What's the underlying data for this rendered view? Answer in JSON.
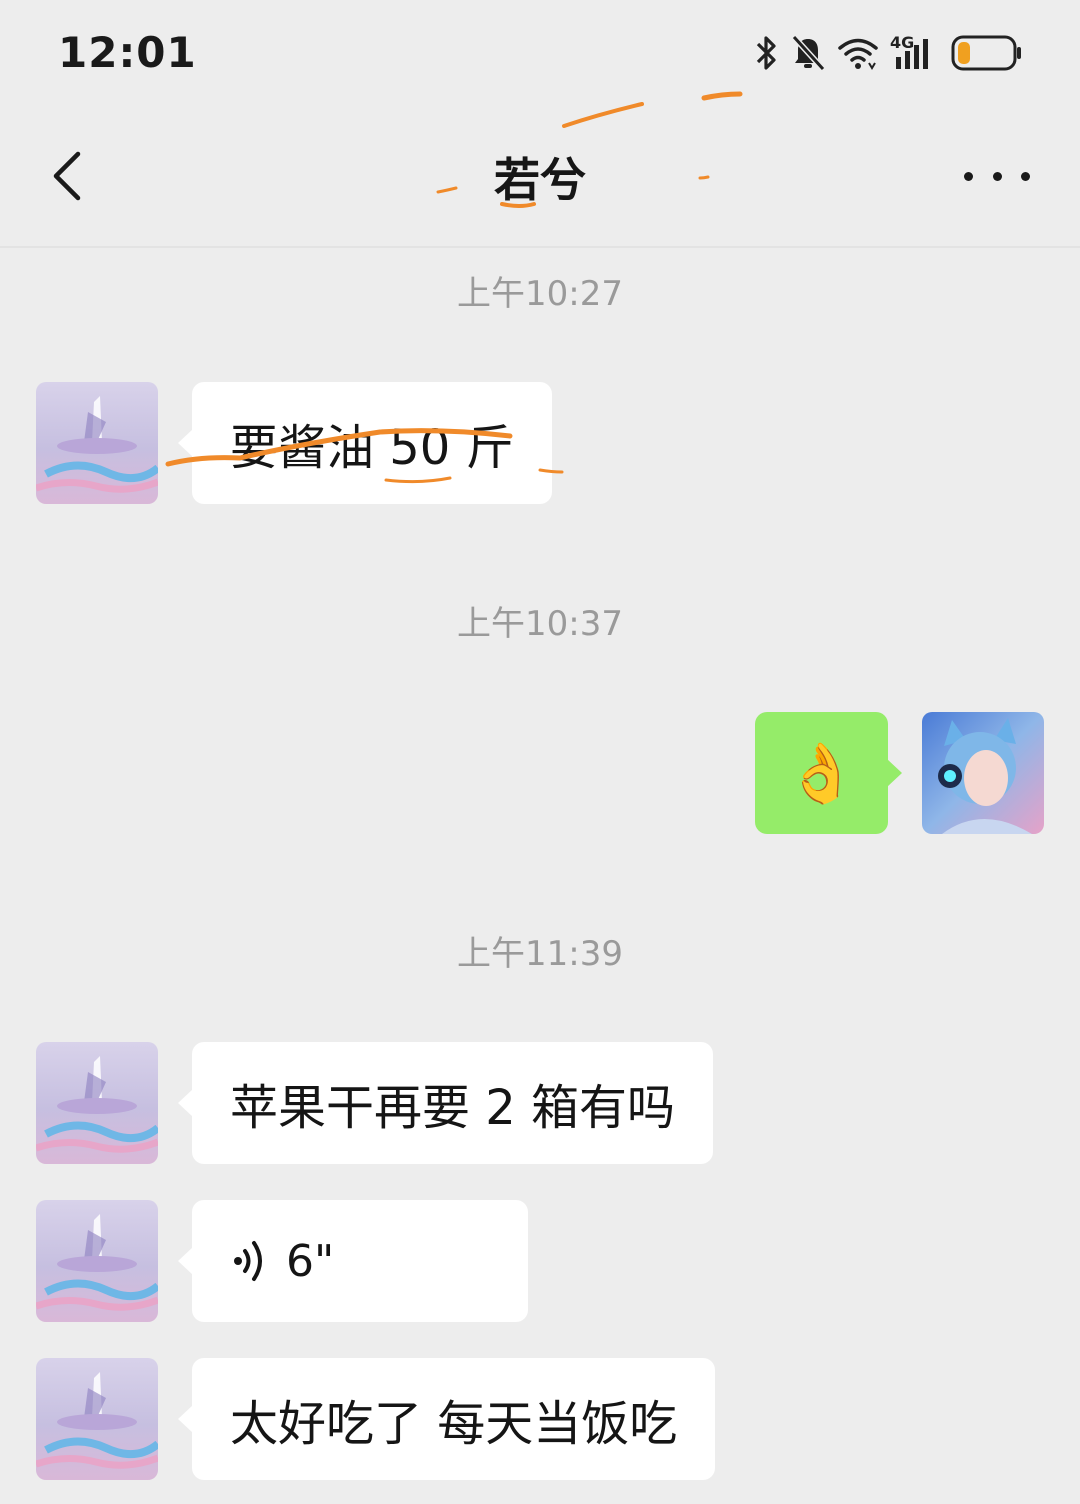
{
  "status_bar": {
    "time": "12:01",
    "icons": [
      "bluetooth-icon",
      "mute-bell-icon",
      "wifi-icon",
      "4g-signal-icon",
      "battery-icon"
    ],
    "network_label": "4G",
    "battery_color": "#f0a020"
  },
  "header": {
    "title": "若兮",
    "back_icon": "chevron-left-icon",
    "more_icon": "more-dots-icon"
  },
  "messages": [
    {
      "type": "timestamp",
      "text": "上午10:27"
    },
    {
      "type": "text",
      "side": "left",
      "text": "要酱油 50 斤"
    },
    {
      "type": "timestamp",
      "text": "上午10:37"
    },
    {
      "type": "emoji",
      "side": "right",
      "emoji": "👌"
    },
    {
      "type": "timestamp",
      "text": "上午11:39"
    },
    {
      "type": "text",
      "side": "left",
      "text": "苹果干再要 2 箱有吗"
    },
    {
      "type": "voice",
      "side": "left",
      "duration": "6\""
    },
    {
      "type": "text",
      "side": "left",
      "text": "太好吃了 每天当饭吃"
    }
  ],
  "colors": {
    "background": "#ededed",
    "bubble_left": "#ffffff",
    "bubble_right": "#95ec69",
    "timestamp_text": "#9a9a9a",
    "scribble": "#f08a2a"
  }
}
